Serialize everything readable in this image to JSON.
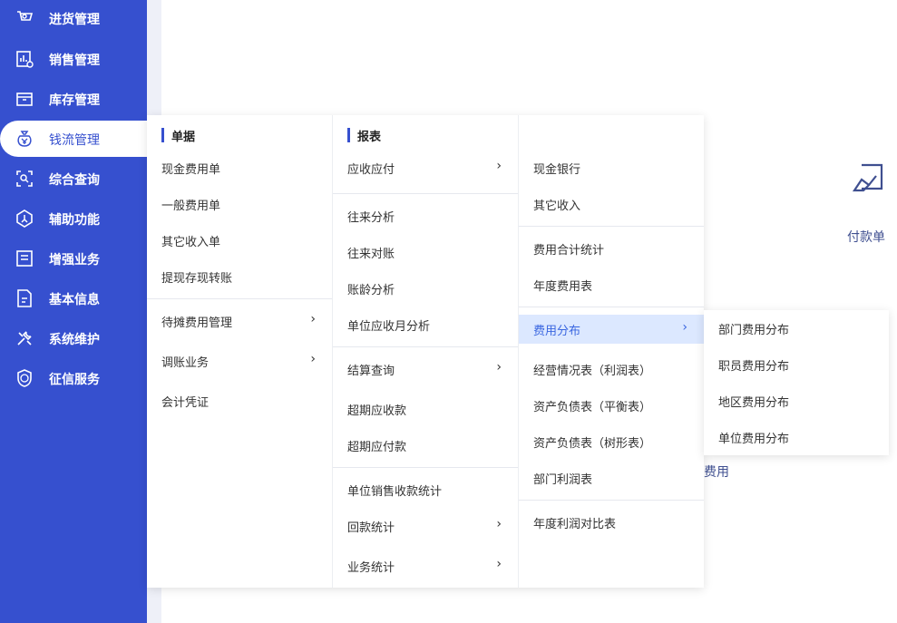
{
  "sidebar": {
    "items": [
      {
        "label": "进货管理",
        "icon": "cart-icon"
      },
      {
        "label": "销售管理",
        "icon": "sales-chart-icon"
      },
      {
        "label": "库存管理",
        "icon": "inventory-box-icon"
      },
      {
        "label": "钱流管理",
        "icon": "money-bag-icon"
      },
      {
        "label": "综合查询",
        "icon": "query-scan-icon"
      },
      {
        "label": "辅助功能",
        "icon": "assist-hexagon-icon"
      },
      {
        "label": "增强业务",
        "icon": "enhance-list-icon"
      },
      {
        "label": "基本信息",
        "icon": "document-icon"
      },
      {
        "label": "系统维护",
        "icon": "tools-icon"
      },
      {
        "label": "征信服务",
        "icon": "credit-shield-icon"
      }
    ],
    "active": "钱流管理",
    "bg_color": "#3650cf"
  },
  "background": {
    "pay_label": "付款单",
    "fee_label": "费用"
  },
  "menu": {
    "col1": {
      "title": "单据",
      "items": [
        {
          "label": "现金费用单"
        },
        {
          "label": "一般费用单"
        },
        {
          "label": "其它收入单"
        },
        {
          "label": "提现存现转账"
        },
        {
          "label": "待摊费用管理"
        },
        {
          "label": "调账业务"
        },
        {
          "label": "会计凭证"
        }
      ]
    },
    "col2": {
      "title": "报表",
      "items": [
        {
          "label": "应收应付"
        },
        {
          "label": "往来分析"
        },
        {
          "label": "往来对账"
        },
        {
          "label": "账龄分析"
        },
        {
          "label": "单位应收月分析"
        },
        {
          "label": "结算查询"
        },
        {
          "label": "超期应收款"
        },
        {
          "label": "超期应付款"
        },
        {
          "label": "单位销售收款统计"
        },
        {
          "label": "回款统计"
        },
        {
          "label": "业务统计"
        }
      ]
    },
    "col3": {
      "items": [
        {
          "label": "现金银行"
        },
        {
          "label": "其它收入"
        },
        {
          "label": "费用合计统计"
        },
        {
          "label": "年度费用表"
        },
        {
          "label": "费用分布"
        },
        {
          "label": "经营情况表（利润表）"
        },
        {
          "label": "资产负债表（平衡表）"
        },
        {
          "label": "资产负债表（树形表）"
        },
        {
          "label": "部门利润表"
        },
        {
          "label": "年度利润对比表"
        }
      ],
      "highlighted": "费用分布"
    },
    "flyout": {
      "items": [
        {
          "label": "部门费用分布"
        },
        {
          "label": "职员费用分布"
        },
        {
          "label": "地区费用分布"
        },
        {
          "label": "单位费用分布"
        }
      ]
    },
    "arrow_glyph": "›",
    "accent_color": "#3650cf",
    "highlight_bg": "#dce8ff"
  }
}
